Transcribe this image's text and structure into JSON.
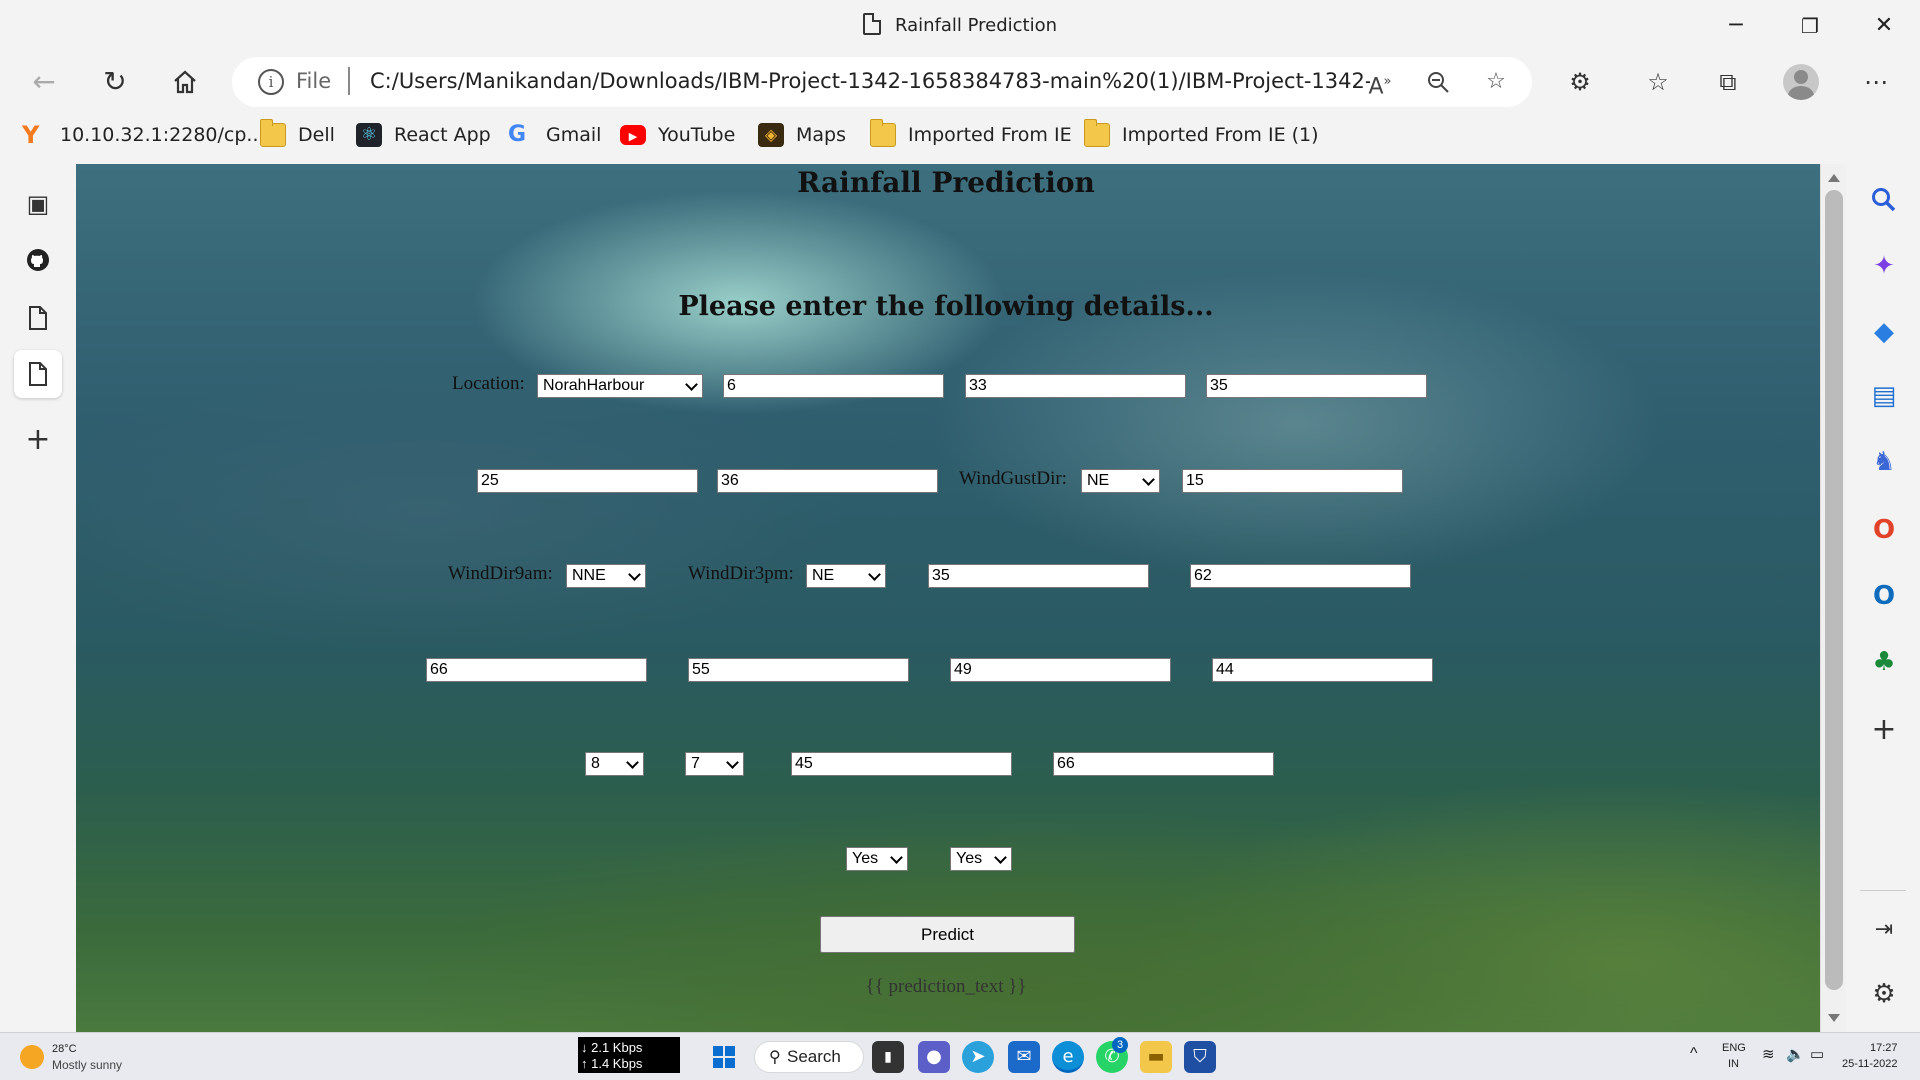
{
  "window": {
    "title": "Rainfall Prediction",
    "minimize": "─",
    "maximize": "❐",
    "close": "✕"
  },
  "address_bar": {
    "scheme": "File",
    "url": "C:/Users/Manikandan/Downloads/IBM-Project-1342-1658384783-main%20(1)/IBM-Project-1342-..."
  },
  "favorites": [
    {
      "label": "10.10.32.1:2280/cp...",
      "icon": "y-logo-icon"
    },
    {
      "label": "Dell",
      "icon": "folder-icon"
    },
    {
      "label": "React App",
      "icon": "react-icon"
    },
    {
      "label": "Gmail",
      "icon": "google-icon"
    },
    {
      "label": "YouTube",
      "icon": "youtube-icon"
    },
    {
      "label": "Maps",
      "icon": "maps-icon"
    },
    {
      "label": "Imported From IE",
      "icon": "folder-icon"
    },
    {
      "label": "Imported From IE (1)",
      "icon": "folder-icon"
    }
  ],
  "page": {
    "title": "Rainfall Prediction",
    "subtitle": "Please enter the following details...",
    "labels": {
      "location": "Location:",
      "windgustdir": "WindGustDir:",
      "winddir9am": "WindDir9am:",
      "winddir3pm": "WindDir3pm:"
    },
    "fields": {
      "location": "NorahHarbour",
      "mintemp": "6",
      "maxtemp": "33",
      "rainfall": "35",
      "evaporation": "25",
      "sunshine": "36",
      "windgustdir": "NE",
      "windgustspeed": "15",
      "winddir9am": "NNE",
      "winddir3pm": "NE",
      "windspeed9am": "35",
      "windspeed3pm": "62",
      "humidity9am": "66",
      "humidity3pm": "55",
      "pressure9am": "49",
      "pressure3pm": "44",
      "cloud9am": "8",
      "cloud3pm": "7",
      "temp9am": "45",
      "temp3pm": "66",
      "raintoday": "Yes",
      "raintomorrow": "Yes"
    },
    "predict_button": "Predict",
    "prediction_text": "{{ prediction_text }}"
  },
  "taskbar": {
    "weather_temp": "28°C",
    "weather_desc": "Mostly sunny",
    "net_down": "↓ 2.1 Kbps",
    "net_up": "↑ 1.4 Kbps",
    "search_label": "Search",
    "lang_top": "ENG",
    "lang_bottom": "IN",
    "time": "17:27",
    "date": "25-11-2022",
    "whatsapp_badge": "3"
  },
  "colors": {
    "accent": "#0067c0",
    "youtube_red": "#ff0000",
    "folder_yellow": "#f3c84a"
  }
}
